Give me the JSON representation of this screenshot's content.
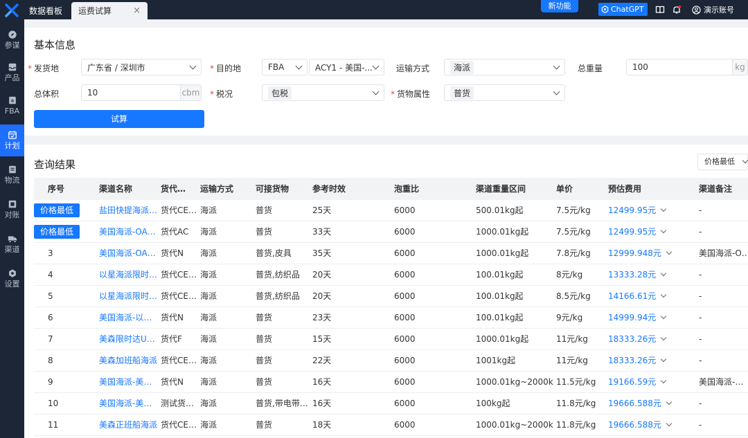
{
  "tabs": {
    "dashboard": "数据看板",
    "current": "运费试算",
    "close": "×"
  },
  "topbar": {
    "new_feature": "新功能",
    "chatgpt": "ChatGPT",
    "account": "演示账号"
  },
  "sidebar": {
    "items": [
      {
        "label": "参谋",
        "icon": "compass-icon"
      },
      {
        "label": "产品",
        "icon": "inbox-icon"
      },
      {
        "label": "FBA",
        "icon": "amazon-icon"
      },
      {
        "label": "计划",
        "icon": "calendar-icon"
      },
      {
        "label": "物流",
        "icon": "document-icon"
      },
      {
        "label": "对账",
        "icon": "wallet-icon"
      },
      {
        "label": "渠道",
        "icon": "truck-icon"
      },
      {
        "label": "设置",
        "icon": "gear-icon"
      }
    ]
  },
  "basic": {
    "title": "基本信息",
    "origin_label": "发货地",
    "origin_value": "广东省 / 深圳市",
    "dest_label": "目的地",
    "dest_type": "FBA",
    "dest_value": "ACY1 - 美国-...",
    "ship_label": "运输方式",
    "ship_value": "海派",
    "weight_label": "总重量",
    "weight_value": "100",
    "weight_unit": "kg",
    "volume_label": "总体积",
    "volume_value": "10",
    "volume_unit": "cbm",
    "tax_label": "税况",
    "tax_value": "包税",
    "cargo_label": "货物属性",
    "cargo_value": "普货",
    "calc_button": "试算"
  },
  "results": {
    "title": "查询结果",
    "sort": "价格最低",
    "badge": "价格最低",
    "columns": [
      "序号",
      "渠道名称",
      "货代…",
      "运输方式",
      "可接货物",
      "参考时效",
      "泡重比",
      "渠道重量区间",
      "单价",
      "预估费用",
      "渠道备注"
    ],
    "rows": [
      {
        "no": "",
        "badge": true,
        "channel": "盐田快提海派…",
        "agent": "货代CE…",
        "mode": "海派",
        "goods": "普货",
        "time": "25天",
        "ratio": "6000",
        "range": "500.01kg起",
        "price": "7.5元/kg",
        "fee": "12499.95元",
        "note": "-"
      },
      {
        "no": "",
        "badge": true,
        "channel": "美国海派-OA…",
        "agent": "货代AC",
        "mode": "海派",
        "goods": "普货",
        "time": "33天",
        "ratio": "6000",
        "range": "1000.01kg起",
        "price": "7.5元/kg",
        "fee": "12499.95元",
        "note": "-"
      },
      {
        "no": "3",
        "badge": false,
        "channel": "美国海派-OA…",
        "agent": "货代N",
        "mode": "海派",
        "goods": "普货,皮具",
        "time": "35天",
        "ratio": "6000",
        "range": "1000.01kg起",
        "price": "7.8元/kg",
        "fee": "12999.948元",
        "note": "美国海派-O…"
      },
      {
        "no": "4",
        "badge": false,
        "channel": "以星海派限时…",
        "agent": "货代CE…",
        "mode": "海派",
        "goods": "普货,纺织品",
        "time": "20天",
        "ratio": "6000",
        "range": "100.01kg起",
        "price": "8元/kg",
        "fee": "13333.28元",
        "note": "-"
      },
      {
        "no": "5",
        "badge": false,
        "channel": "以星海派限时…",
        "agent": "货代CE…",
        "mode": "海派",
        "goods": "普货,纺织品",
        "time": "20天",
        "ratio": "6000",
        "range": "100.01kg起",
        "price": "8.5元/kg",
        "fee": "14166.61元",
        "note": "-"
      },
      {
        "no": "6",
        "badge": false,
        "channel": "美国海派-以…",
        "agent": "货代N",
        "mode": "海派",
        "goods": "普货",
        "time": "23天",
        "ratio": "6000",
        "range": "100.01kg起",
        "price": "9元/kg",
        "fee": "14999.94元",
        "note": "-"
      },
      {
        "no": "7",
        "badge": false,
        "channel": "美森限时达U…",
        "agent": "货代F",
        "mode": "海派",
        "goods": "普货",
        "time": "15天",
        "ratio": "6000",
        "range": "1000.01kg起",
        "price": "11元/kg",
        "fee": "18333.26元",
        "note": "-"
      },
      {
        "no": "8",
        "badge": false,
        "channel": "美森加班船海派",
        "agent": "货代CE…",
        "mode": "海派",
        "goods": "普货",
        "time": "22天",
        "ratio": "6000",
        "range": "1001kg起",
        "price": "11元/kg",
        "fee": "18333.26元",
        "note": "-"
      },
      {
        "no": "9",
        "badge": false,
        "channel": "美国海派-美…",
        "agent": "货代N",
        "mode": "海派",
        "goods": "普货",
        "time": "16天",
        "ratio": "6000",
        "range": "1000.01kg~2000kg",
        "price": "11.5元/kg",
        "fee": "19166.59元",
        "note": "美国海派-…"
      },
      {
        "no": "10",
        "badge": false,
        "channel": "美国海派-美…",
        "agent": "测试货…",
        "mode": "海派",
        "goods": "普货,带电带…",
        "time": "16天",
        "ratio": "6000",
        "range": "100kg起",
        "price": "11.8元/kg",
        "fee": "19666.588元",
        "note": "-"
      },
      {
        "no": "11",
        "badge": false,
        "channel": "美森正班船海派",
        "agent": "货代CE…",
        "mode": "海派",
        "goods": "普货",
        "time": "18天",
        "ratio": "6000",
        "range": "1000.01kg~2000kg",
        "price": "11.8元/kg",
        "fee": "19666.588元",
        "note": "-"
      }
    ]
  }
}
